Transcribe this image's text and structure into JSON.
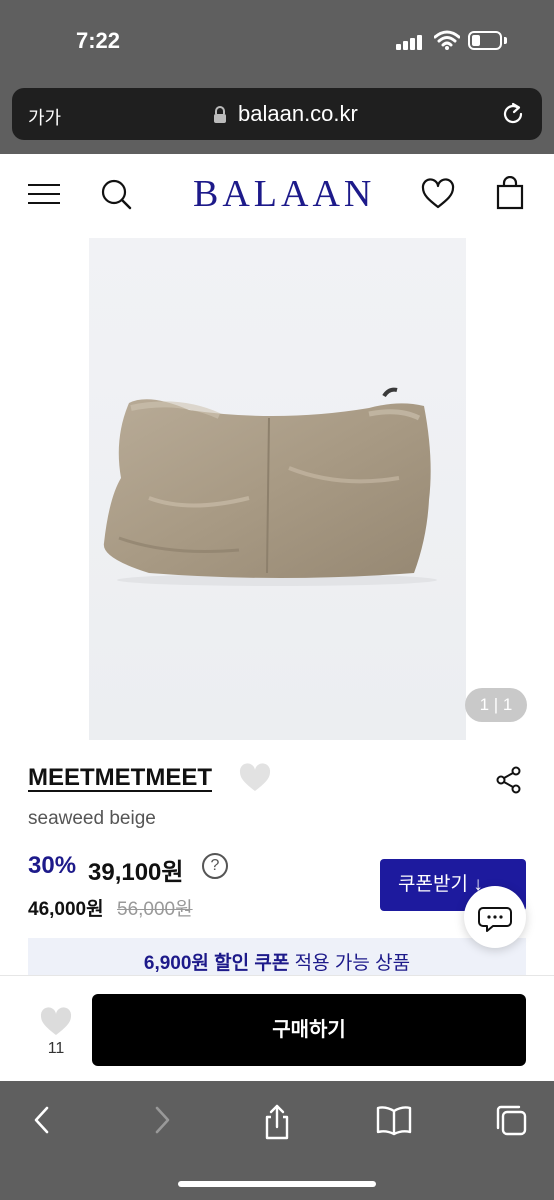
{
  "status": {
    "time": "7:22"
  },
  "browser": {
    "text_size_label": "가가",
    "url": "balaan.co.kr"
  },
  "site": {
    "logo": "BALAAN"
  },
  "product": {
    "image_counter": "1 | 1",
    "brand": "MEETMETMEET",
    "name": "seaweed beige",
    "discount": "30%",
    "price": "39,100원",
    "help": "?",
    "price_secondary": "46,000원",
    "original_price": "56,000원",
    "coupon_button": "쿠폰받기 ↓",
    "coupon_amount": "6,900원 할인 쿠폰",
    "coupon_suffix": " 적용 가능 상품"
  },
  "bottom": {
    "like_count": "11",
    "buy_label": "구매하기"
  },
  "colors": {
    "brand_navy": "#1d1a8a",
    "coupon_blue": "#1d1a9e",
    "browser_chrome": "#5f5f5f"
  },
  "icons": [
    "menu-icon",
    "search-icon",
    "heart-icon",
    "bag-icon",
    "share-icon",
    "chat-icon",
    "back-icon",
    "forward-icon",
    "share-sheet-icon",
    "bookmarks-icon",
    "tabs-icon"
  ]
}
